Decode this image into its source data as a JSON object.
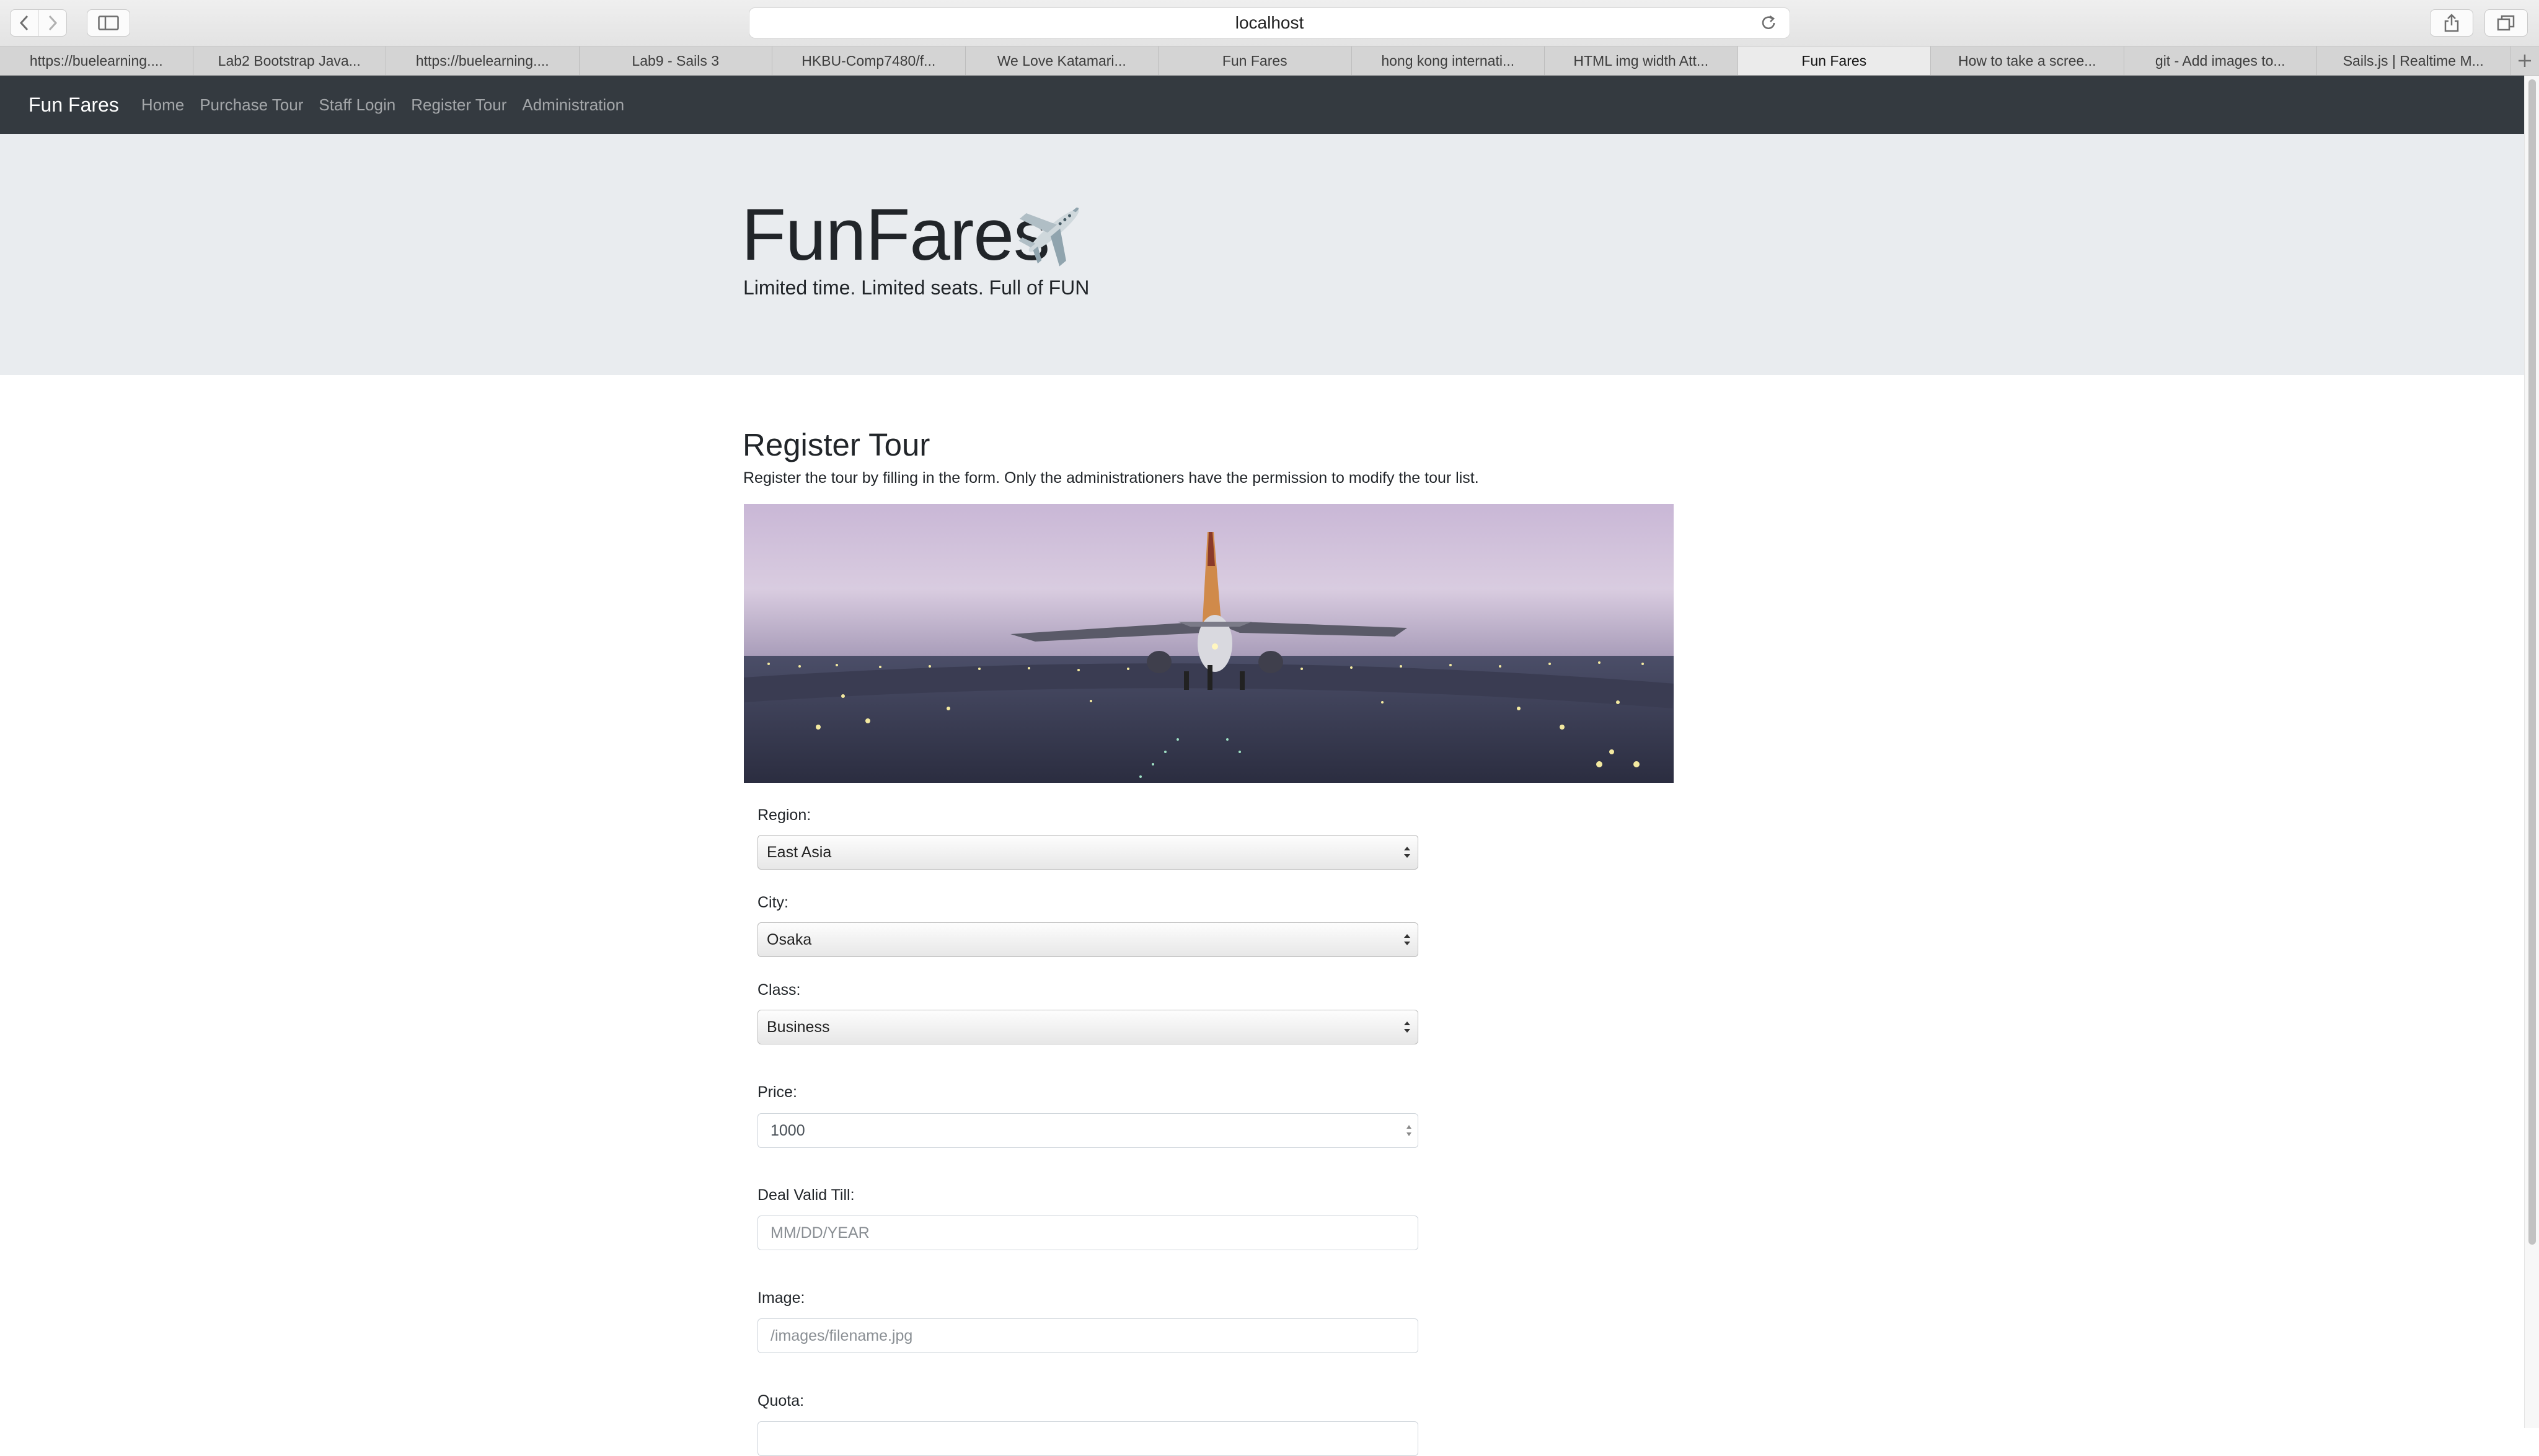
{
  "browser": {
    "address": "localhost",
    "tabs": [
      "https://buelearning....",
      "Lab2 Bootstrap Java...",
      "https://buelearning....",
      "Lab9 - Sails 3",
      "HKBU-Comp7480/f...",
      "We Love Katamari...",
      "Fun Fares",
      "hong kong internati...",
      "HTML img width Att...",
      "Fun Fares",
      "How to take a scree...",
      "git - Add images to...",
      "Sails.js | Realtime M..."
    ],
    "active_tab_index": 9
  },
  "navbar": {
    "brand": "Fun Fares",
    "links": [
      "Home",
      "Purchase Tour",
      "Staff Login",
      "Register Tour",
      "Administration"
    ]
  },
  "hero": {
    "title": "FunFares",
    "subtitle": "Limited time. Limited seats. Full of FUN"
  },
  "page": {
    "title": "Register Tour",
    "description": "Register the tour by filling in the form. Only the administrationers have the permission to modify the tour list."
  },
  "form": {
    "region": {
      "label": "Region:",
      "value": "East Asia"
    },
    "city": {
      "label": "City:",
      "value": "Osaka"
    },
    "class": {
      "label": "Class:",
      "value": "Business"
    },
    "price": {
      "label": "Price:",
      "value": "1000"
    },
    "deal_valid_till": {
      "label": "Deal Valid Till:",
      "placeholder": "MM/DD/YEAR"
    },
    "image": {
      "label": "Image:",
      "placeholder": "/images/filename.jpg"
    },
    "quota": {
      "label": "Quota:"
    }
  },
  "icons": {
    "back": "back-arrow-icon",
    "forward": "forward-arrow-icon",
    "sidebar": "sidebar-icon",
    "reload": "reload-icon",
    "share": "share-icon",
    "tabs": "tabs-overview-icon",
    "new_tab": "plus-icon",
    "hero_emoji": "airplane-icon"
  },
  "colors": {
    "navbar_bg": "#343a40",
    "jumbotron_bg": "#e9ecef",
    "brand_text": "#ffffff"
  }
}
